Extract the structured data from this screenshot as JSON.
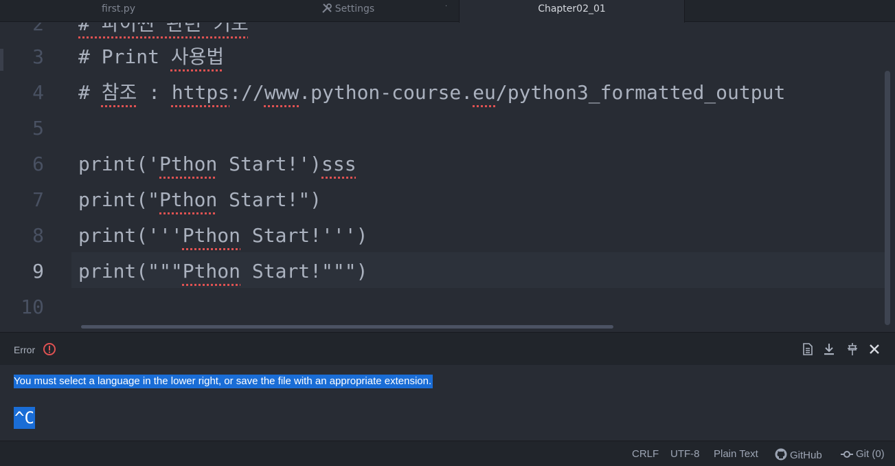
{
  "tabs": {
    "first": "first.py",
    "settings": "Settings",
    "active": "Chapter02_01"
  },
  "editor": {
    "lines": [
      {
        "num": "2",
        "text": "# 파이썬 관련 키노"
      },
      {
        "num": "3",
        "pre": "# Print ",
        "sq": "사용법"
      },
      {
        "num": "4",
        "pre": "# ",
        "sq1": "참조",
        "mid": " : ",
        "sq2": "https",
        "mid2": "://",
        "sq3": "www",
        "mid3": ".python-course.",
        "sq4": "eu",
        "post": "/python3_formatted_output"
      },
      {
        "num": "5"
      },
      {
        "num": "6",
        "pre": "print('",
        "sq1": "Pthon",
        "mid": " Start!')",
        "sq2": "sss"
      },
      {
        "num": "7",
        "pre": "print(\"",
        "sq1": "Pthon",
        "post": " Start!\")"
      },
      {
        "num": "8",
        "pre": "print('''",
        "sq1": "Pthon",
        "post": " Start!''')"
      },
      {
        "num": "9",
        "pre": "print(\"\"\"",
        "sq1": "Pthon",
        "post": " Start!\"\"\")"
      },
      {
        "num": "10"
      }
    ]
  },
  "panel": {
    "title": "Error",
    "message": "You must select a language in the lower right, or save the file with an appropriate extension.",
    "interrupt": "^C"
  },
  "status": {
    "line_ending": "CRLF",
    "encoding": "UTF-8",
    "grammar": "Plain Text",
    "github": "GitHub",
    "git": "Git (0)"
  },
  "colors": {
    "accent_selection": "#1a6dd6",
    "error": "#e05252",
    "background": "#282c34"
  }
}
